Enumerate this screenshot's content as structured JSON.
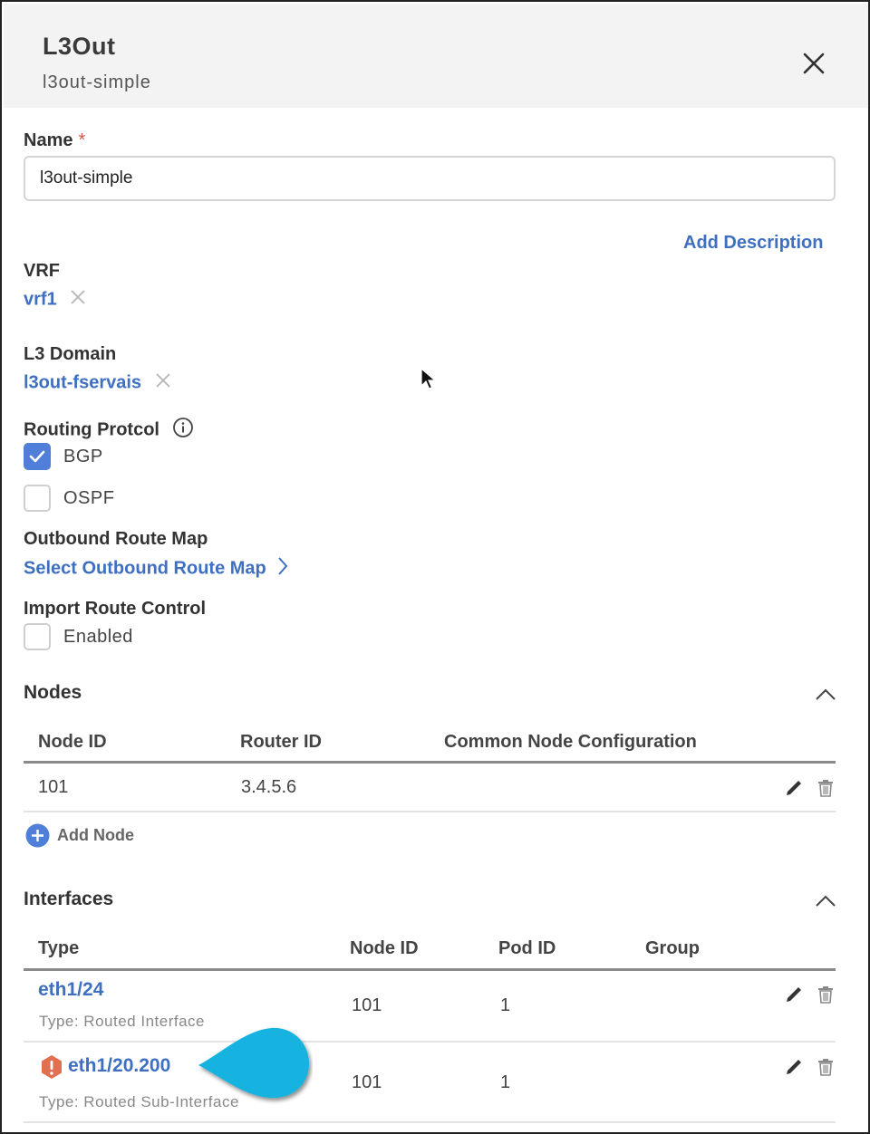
{
  "panel": {
    "title": "L3Out",
    "subtitle": "l3out-simple"
  },
  "form": {
    "name_label": "Name",
    "name_required": "*",
    "name_value": "l3out-simple",
    "add_description": "Add Description",
    "vrf_label": "VRF",
    "vrf_value": "vrf1",
    "l3domain_label": "L3 Domain",
    "l3domain_value": "l3out-fservais",
    "routing_protocol_label": "Routing Protcol",
    "protocols": [
      {
        "label": "BGP",
        "checked": true
      },
      {
        "label": "OSPF",
        "checked": false
      }
    ],
    "outbound_label": "Outbound Route Map",
    "outbound_link": "Select Outbound Route Map",
    "import_label": "Import Route Control",
    "import_option": "Enabled",
    "import_checked": false
  },
  "nodes": {
    "title": "Nodes",
    "columns": [
      "Node ID",
      "Router ID",
      "Common Node Configuration"
    ],
    "rows": [
      {
        "node_id": "101",
        "router_id": "3.4.5.6",
        "common": ""
      }
    ],
    "add_label": "Add Node"
  },
  "interfaces": {
    "title": "Interfaces",
    "columns": [
      "Type",
      "Node ID",
      "Pod ID",
      "Group"
    ],
    "rows": [
      {
        "name": "eth1/24",
        "type": "Type: Routed Interface",
        "node_id": "101",
        "pod_id": "1",
        "group": "",
        "warning": false
      },
      {
        "name": "eth1/20.200",
        "type": "Type: Routed Sub-Interface",
        "node_id": "101",
        "pod_id": "1",
        "group": "",
        "warning": true
      }
    ]
  },
  "icons": {
    "close": "close-icon",
    "remove": "x-icon",
    "info": "info-icon",
    "chevron_right": "chevron-right-icon",
    "chevron_up": "chevron-up-icon",
    "edit": "pencil-icon",
    "delete": "trash-icon",
    "add": "plus-circle-icon",
    "warning": "warning-icon",
    "check": "check-icon"
  },
  "colors": {
    "link": "#3e6fc0",
    "checkbox_checked": "#4f7fd8",
    "header_bg": "#f3f3f3",
    "warning": "#e0704f",
    "callout": "#12b3e0",
    "required": "#d9534f"
  }
}
